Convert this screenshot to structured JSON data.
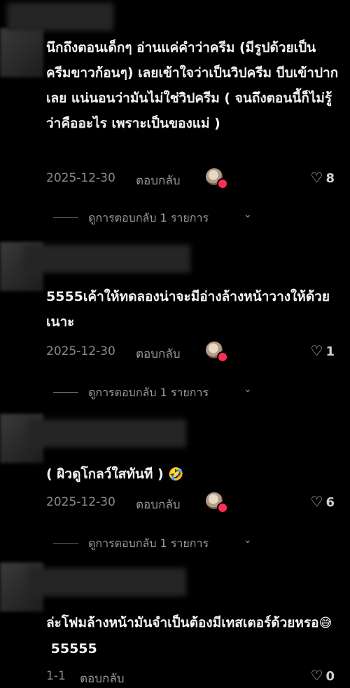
{
  "comments": [
    {
      "text": "นึกถึงตอนเด็กๆ อ่านแค่คำว่าครีม (มีรูปด้วยเป็นครีมขาวก้อนๆ) เลยเข้าใจว่าเป็นวิปครีม บีบเข้าปากเลย แน่นอนว่ามันไม่ใช่วิปครีม ( จนถึงตอนนี้ก็ไม่รู้ว่าคืออะไร เพราะเป็นของแม่ )",
      "date": "2025-12-30",
      "reply_label": "ตอบกลับ",
      "likes": "8",
      "view_replies": "ดูการตอบกลับ 1 รายการ"
    },
    {
      "text": "5555เค้าให้ทดลองน่าจะมีอ่างล้างหน้าวางให้ด้วยเนาะ",
      "date": "2025-12-30",
      "reply_label": "ตอบกลับ",
      "likes": "1",
      "view_replies": "ดูการตอบกลับ 1 รายการ"
    },
    {
      "text": "( ผิวดูโกลว์ใสทันที )",
      "emoji": "🤣",
      "date": "2025-12-30",
      "reply_label": "ตอบกลับ",
      "likes": "6",
      "view_replies": "ดูการตอบกลับ 1 รายการ"
    },
    {
      "text": "ล่ะโฟมล้างหน้ามันจำเป็นต้องมีเทสเตอร์ด้วยหรอ",
      "emoji": "😅",
      "text_after": "55555",
      "date": "1-1",
      "reply_label": "ตอบกลับ",
      "likes": "0"
    }
  ],
  "icons": {
    "heart": "heart-outline-icon",
    "chevron": "chevron-down-icon"
  },
  "colors": {
    "background": "#000000",
    "text": "#f2f2f2",
    "muted": "#8a8a8a",
    "badge": "#ff2d55"
  }
}
